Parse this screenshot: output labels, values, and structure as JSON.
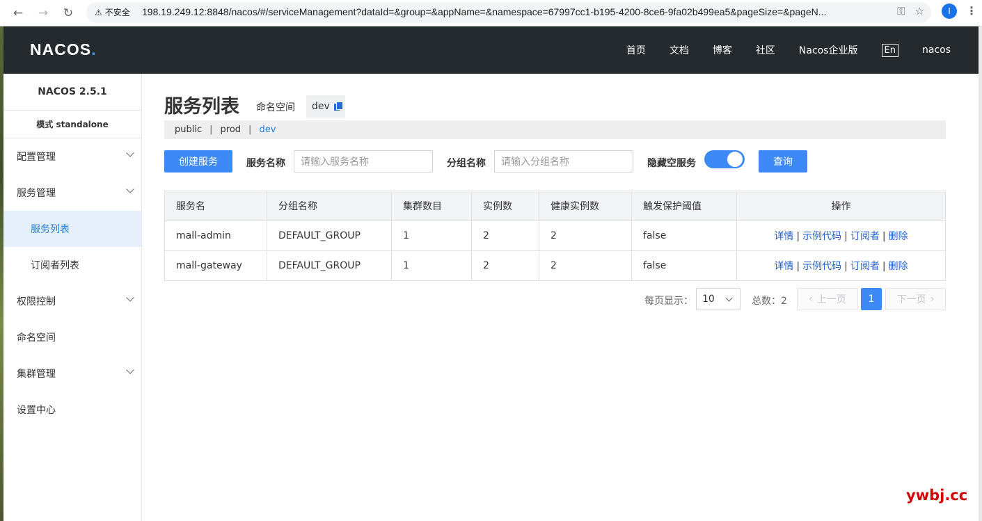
{
  "browser": {
    "insecure_label": "不安全",
    "url": "198.19.249.12:8848/nacos/#/serviceManagement?dataId=&group=&appName=&namespace=67997cc1-b195-4200-8ce6-9fa02b499ea5&pageSize=&pageN...",
    "profile_initial": "I"
  },
  "header": {
    "logo_main": "NACOS",
    "logo_dot": ".",
    "nav": [
      "首页",
      "文档",
      "博客",
      "社区",
      "Nacos企业版"
    ],
    "lang": "En",
    "user": "nacos"
  },
  "sidebar": {
    "version": "NACOS 2.5.1",
    "mode": "模式 standalone",
    "items": [
      {
        "label": "配置管理"
      },
      {
        "label": "服务管理"
      },
      {
        "label": "服务列表"
      },
      {
        "label": "订阅者列表"
      },
      {
        "label": "权限控制"
      },
      {
        "label": "命名空间"
      },
      {
        "label": "集群管理"
      },
      {
        "label": "设置中心"
      }
    ]
  },
  "main": {
    "title": "服务列表",
    "ns_label": "命名空间",
    "ns_current": "dev",
    "namespaces": [
      "public",
      "prod",
      "dev"
    ],
    "ns_sep": "|",
    "create_button": "创建服务",
    "filter_service_label": "服务名称",
    "filter_service_placeholder": "请输入服务名称",
    "filter_group_label": "分组名称",
    "filter_group_placeholder": "请输入分组名称",
    "hide_empty_label": "隐藏空服务",
    "hide_empty_on": true,
    "query_button": "查询"
  },
  "table": {
    "headers": [
      "服务名",
      "分组名称",
      "集群数目",
      "实例数",
      "健康实例数",
      "触发保护阈值",
      "操作"
    ],
    "rows": [
      {
        "service": "mall-admin",
        "group": "DEFAULT_GROUP",
        "clusters": "1",
        "instances": "2",
        "healthy": "2",
        "threshold": "false"
      },
      {
        "service": "mall-gateway",
        "group": "DEFAULT_GROUP",
        "clusters": "1",
        "instances": "2",
        "healthy": "2",
        "threshold": "false"
      }
    ],
    "ops": [
      "详情",
      "示例代码",
      "订阅者",
      "删除"
    ],
    "op_sep": "|"
  },
  "pagination": {
    "per_page_label": "每页显示：",
    "per_page_value": "10",
    "total_label": "总数：2",
    "prev": "上一页",
    "next": "下一页",
    "current_page": "1"
  },
  "watermark": "ywbj.cc",
  "colors": {
    "accent": "#3d8af7",
    "header_bg": "#252a2f",
    "link": "#1f5fd0",
    "active_bg": "#e5f0fb"
  }
}
